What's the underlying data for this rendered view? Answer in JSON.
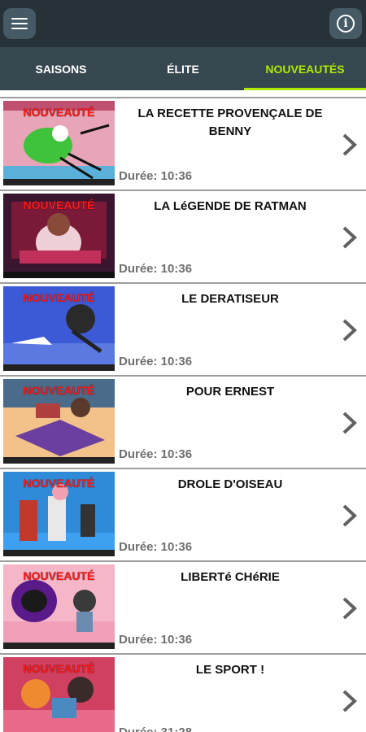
{
  "colors": {
    "topbar": "#263238",
    "tabbar": "#37474f",
    "accent": "#aeea00",
    "badge": "#ff1a1a"
  },
  "header": {
    "menu_icon": "hamburger-menu-icon",
    "info_icon": "info-icon",
    "info_glyph": "i"
  },
  "tabs": [
    {
      "label": "SAISONS",
      "active": false
    },
    {
      "label": "ÉLITE",
      "active": false
    },
    {
      "label": "NOUVEAUTÉS",
      "active": true
    }
  ],
  "episodes": [
    {
      "badge": "NOUVEAUTÉ",
      "title": "LA RECETTE PROVENÇALE DE BENNY",
      "duration": "Durée: 10:36"
    },
    {
      "badge": "NOUVEAUTÉ",
      "title": "LA LéGENDE DE RATMAN",
      "duration": "Durée: 10:36"
    },
    {
      "badge": "NOUVEAUTÉ",
      "title": "LE DERATISEUR",
      "duration": "Durée: 10:36"
    },
    {
      "badge": "NOUVEAUTÉ",
      "title": "POUR ERNEST",
      "duration": "Durée: 10:36"
    },
    {
      "badge": "NOUVEAUTÉ",
      "title": "DROLE D'OISEAU",
      "duration": "Durée: 10:36"
    },
    {
      "badge": "NOUVEAUTÉ",
      "title": "LIBERTé CHéRIE",
      "duration": "Durée: 10:36"
    },
    {
      "badge": "NOUVEAUTÉ",
      "title": "LE SPORT !",
      "duration": "Durée: 31:28"
    }
  ]
}
